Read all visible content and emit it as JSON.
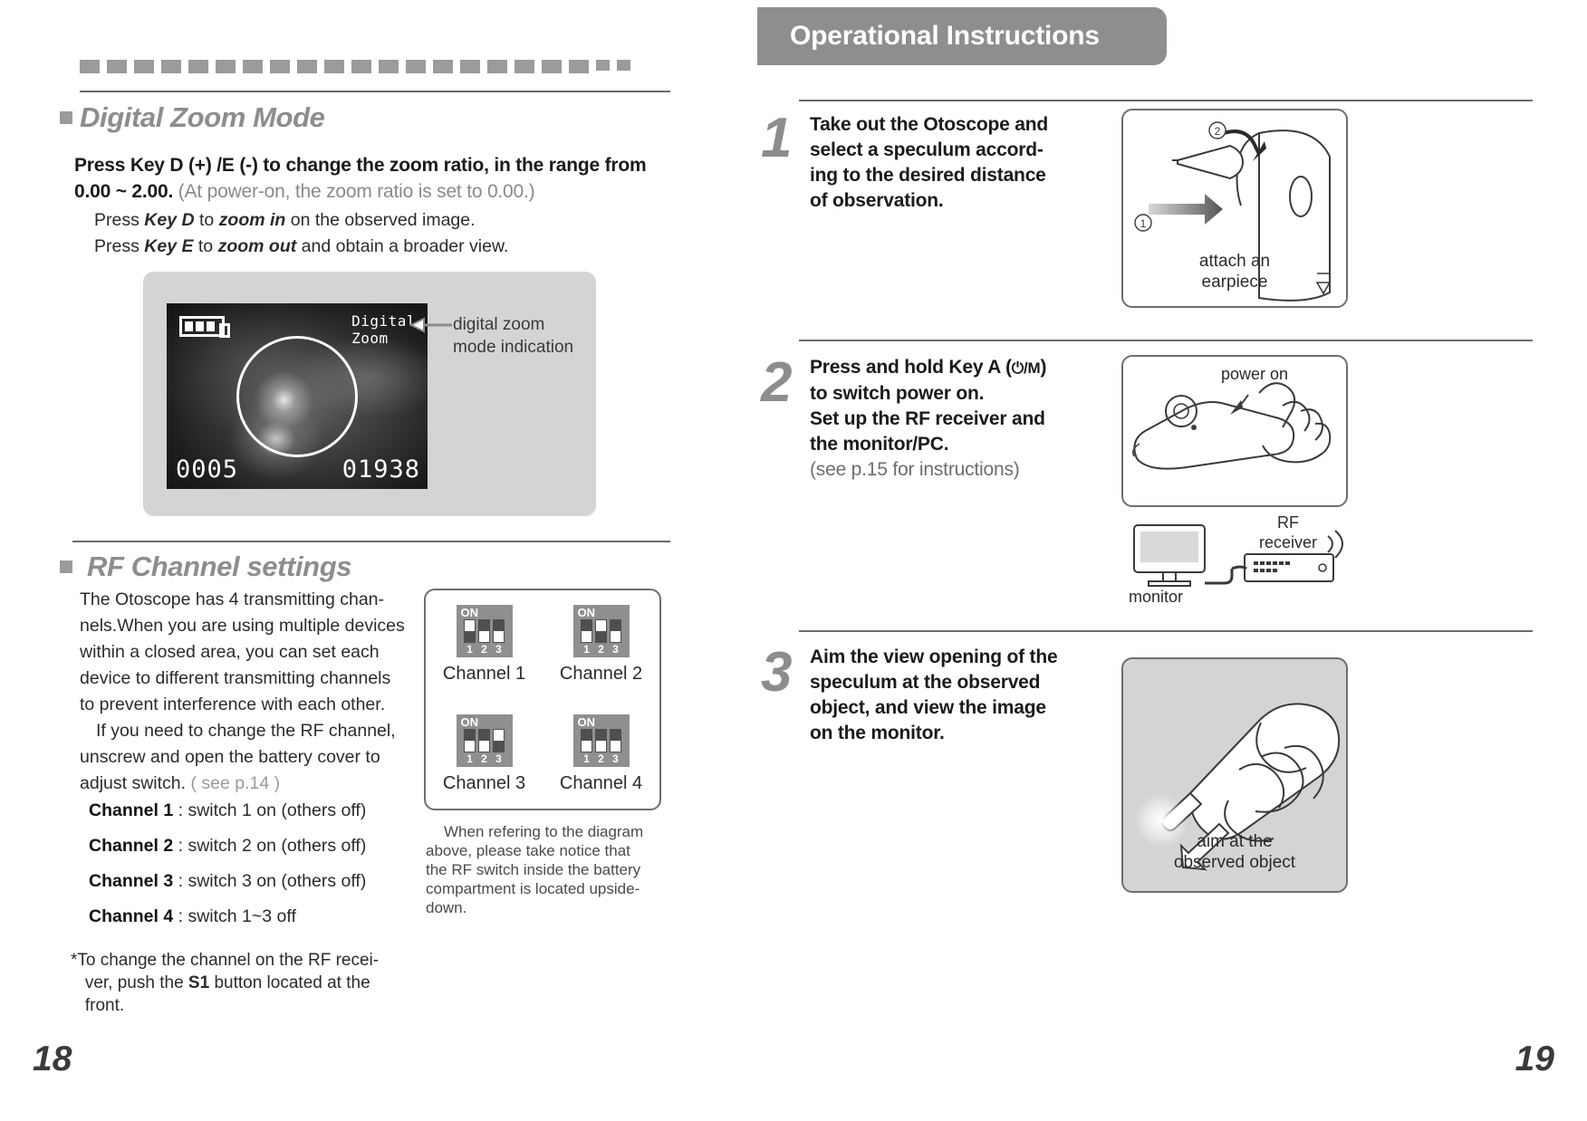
{
  "left_page": {
    "page_number": "18",
    "section1": {
      "title": "Digital Zoom Mode",
      "lead_bold": "Press Key D (+) /E (-) to change the zoom ratio, in the range from 0.00 ~ 2.00.",
      "lead_paren": "(At power-on, the zoom ratio is set to 0.00.)",
      "line_d_pre": "Press ",
      "line_d_key": "Key D",
      "line_d_mid": " to ",
      "line_d_action": "zoom in",
      "line_d_post": "  on the observed image.",
      "line_e_pre": "Press ",
      "line_e_key": "Key E",
      "line_e_mid": " to ",
      "line_e_action": "zoom out",
      "line_e_post": "  and obtain a broader view.",
      "lcd": {
        "mode_indicator_line1": "Digital",
        "mode_indicator_line2": "Zoom",
        "counter_left": "0005",
        "counter_right": "01938",
        "battery_icon": "battery-icon"
      },
      "callout": "digital zoom\nmode indication",
      "callout_line1": "digital zoom",
      "callout_line2": "mode indication"
    },
    "section2": {
      "title": "RF Channel settings",
      "para1": "The Otoscope has 4 transmitting chan-nels.When you are using multiple devices within a  closed area,  you can set each device to different transmitting channels to prevent interference with each other.",
      "para1_lines": [
        "The Otoscope has 4 transmitting chan-",
        "nels.When you are using multiple devices",
        "within a  closed area,  you can set each",
        "device to different transmitting channels",
        "to prevent interference with each other."
      ],
      "para2_lines": [
        "If you need to change the RF channel,",
        "unscrew and open the battery cover to",
        "adjust switch."
      ],
      "para2_ref": "( see p.14 )",
      "channels": [
        {
          "name": "Channel 1",
          "desc": " : switch 1 on (others off)"
        },
        {
          "name": "Channel 2",
          "desc": " : switch 2 on (others off)"
        },
        {
          "name": "Channel 3",
          "desc": " : switch 3 on (others off)"
        },
        {
          "name": "Channel 4",
          "desc": " : switch 1~3 off"
        }
      ],
      "footnote_lines": [
        "*To change the channel on the RF recei-",
        "   ver, push the S1 button located at the",
        "   front."
      ],
      "footnote_pre": "*To change the channel on the RF recei-ver, push the ",
      "footnote_bold": "S1",
      "footnote_post": " button located at the front.",
      "dip_on_label": "ON",
      "dip_numbers": [
        "1",
        "2",
        "3"
      ],
      "dip_switches": [
        {
          "label": "Channel 1",
          "positions": [
            "up",
            "down",
            "down"
          ]
        },
        {
          "label": "Channel 2",
          "positions": [
            "down",
            "up",
            "down"
          ]
        },
        {
          "label": "Channel 3",
          "positions": [
            "down",
            "down",
            "up"
          ]
        },
        {
          "label": "Channel 4",
          "positions": [
            "down",
            "down",
            "down"
          ]
        }
      ],
      "dip_note_lines": [
        "When refering to the diagram",
        "above,  please take notice that",
        "the RF switch inside the  battery",
        "compartment is located upside-",
        "down."
      ]
    }
  },
  "right_page": {
    "page_number": "19",
    "banner_title": "Operational Instructions",
    "steps": [
      {
        "number": "1",
        "text_lines": [
          "Take out the Otoscope and",
          "select a speculum accord-",
          "ing to the desired distance",
          "of observation."
        ],
        "illustration": {
          "caption_line1": "attach an",
          "caption_line2": "earpiece",
          "marker_1": "①",
          "marker_2": "②"
        }
      },
      {
        "number": "2",
        "text_line1_pre": "Press  and hold  Key A (",
        "text_line1_symbol": "⏻/M",
        "text_line1_post": ")",
        "text_lines": [
          "to switch power on.",
          "Set up the RF receiver and",
          "the monitor/PC."
        ],
        "text_note": "(see p.15 for instructions)",
        "illustration": {
          "caption_power_on": "power on",
          "label_rf_receiver_line1": "RF",
          "label_rf_receiver_line2": "receiver",
          "label_monitor": "monitor"
        }
      },
      {
        "number": "3",
        "text_lines": [
          "Aim the view opening of the",
          "speculum at  the  observed",
          "object, and view the image",
          "on the monitor."
        ],
        "illustration": {
          "caption_line1": "aim at the",
          "caption_line2": "observed object"
        }
      }
    ]
  },
  "colors": {
    "accent_gray": "#8e8e91",
    "rule_gray": "#6b6b6b",
    "panel_gray": "#d4d4d4",
    "text_dark": "#1b1b1b",
    "text_soft": "#6d6d6d"
  }
}
